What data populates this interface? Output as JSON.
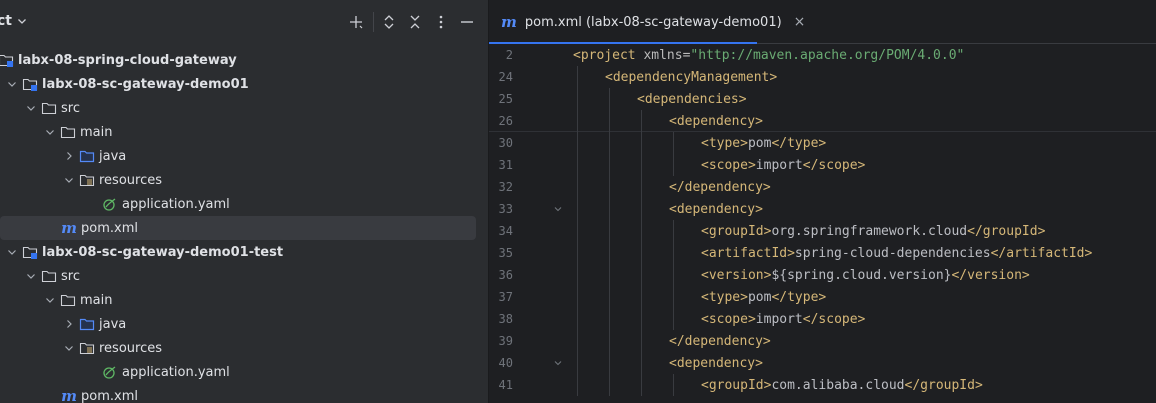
{
  "project_panel": {
    "title": "ct",
    "tree": [
      {
        "label": "labx-08-spring-cloud-gateway",
        "bold": true,
        "type": "module",
        "indent": 0,
        "arrow": "none"
      },
      {
        "label": "labx-08-sc-gateway-demo01",
        "bold": true,
        "type": "module",
        "indent": 0,
        "arrow": "down"
      },
      {
        "label": "src",
        "bold": false,
        "type": "folder",
        "indent": 1,
        "arrow": "down"
      },
      {
        "label": "main",
        "bold": false,
        "type": "folder",
        "indent": 2,
        "arrow": "down"
      },
      {
        "label": "java",
        "bold": false,
        "type": "source-folder",
        "indent": 3,
        "arrow": "right"
      },
      {
        "label": "resources",
        "bold": false,
        "type": "resources-folder",
        "indent": 3,
        "arrow": "down"
      },
      {
        "label": "application.yaml",
        "bold": false,
        "type": "spring-file",
        "indent": 4,
        "arrow": "none"
      },
      {
        "label": "pom.xml",
        "bold": false,
        "type": "maven-file",
        "indent": 1,
        "arrow": "none",
        "selected": true
      },
      {
        "label": "labx-08-sc-gateway-demo01-test",
        "bold": true,
        "type": "module",
        "indent": 0,
        "arrow": "down"
      },
      {
        "label": "src",
        "bold": false,
        "type": "folder",
        "indent": 1,
        "arrow": "down"
      },
      {
        "label": "main",
        "bold": false,
        "type": "folder",
        "indent": 2,
        "arrow": "down"
      },
      {
        "label": "java",
        "bold": false,
        "type": "source-folder",
        "indent": 3,
        "arrow": "right"
      },
      {
        "label": "resources",
        "bold": false,
        "type": "resources-folder",
        "indent": 3,
        "arrow": "down"
      },
      {
        "label": "application.yaml",
        "bold": false,
        "type": "spring-file",
        "indent": 4,
        "arrow": "none"
      },
      {
        "label": "pom.xml",
        "bold": false,
        "type": "maven-file",
        "indent": 1,
        "arrow": "none"
      }
    ],
    "header_icons": [
      "add-icon",
      "expand-all-icon",
      "collapse-all-icon",
      "more-icon",
      "minimize-icon"
    ]
  },
  "editor": {
    "tab": {
      "icon_glyph": "m",
      "label": "pom.xml (labx-08-sc-gateway-demo01)",
      "close_glyph": "×"
    },
    "sticky_lines": [
      {
        "num": "2",
        "indent": 0,
        "parts": [
          [
            "tag",
            "<project "
          ],
          [
            "attr",
            "xmlns="
          ],
          [
            "aval",
            "\"http://maven.apache.org/POM/4.0.0\""
          ]
        ]
      },
      {
        "num": "24",
        "indent": 1,
        "parts": [
          [
            "tag",
            "<dependencyManagement>"
          ]
        ]
      },
      {
        "num": "25",
        "indent": 2,
        "parts": [
          [
            "tag",
            "<dependencies>"
          ]
        ]
      },
      {
        "num": "26",
        "indent": 3,
        "parts": [
          [
            "tag",
            "<dependency>"
          ]
        ]
      }
    ],
    "lines": [
      {
        "num": "30",
        "indent": 4,
        "parts": [
          [
            "tag",
            "<type>"
          ],
          [
            "txt",
            "pom"
          ],
          [
            "tag",
            "</type>"
          ]
        ]
      },
      {
        "num": "31",
        "indent": 4,
        "parts": [
          [
            "tag",
            "<scope>"
          ],
          [
            "txt",
            "import"
          ],
          [
            "tag",
            "</scope>"
          ]
        ]
      },
      {
        "num": "32",
        "indent": 3,
        "parts": [
          [
            "tag",
            "</dependency>"
          ]
        ]
      },
      {
        "num": "33",
        "indent": 3,
        "fold": true,
        "parts": [
          [
            "tag",
            "<dependency>"
          ]
        ]
      },
      {
        "num": "34",
        "indent": 4,
        "parts": [
          [
            "tag",
            "<groupId>"
          ],
          [
            "txt",
            "org.springframework.cloud"
          ],
          [
            "tag",
            "</groupId>"
          ]
        ]
      },
      {
        "num": "35",
        "indent": 4,
        "parts": [
          [
            "tag",
            "<artifactId>"
          ],
          [
            "txt",
            "spring-cloud-dependencies"
          ],
          [
            "tag",
            "</artifactId>"
          ]
        ]
      },
      {
        "num": "36",
        "indent": 4,
        "parts": [
          [
            "tag",
            "<version>"
          ],
          [
            "txt",
            "${spring.cloud.version}"
          ],
          [
            "tag",
            "</version>"
          ]
        ]
      },
      {
        "num": "37",
        "indent": 4,
        "parts": [
          [
            "tag",
            "<type>"
          ],
          [
            "txt",
            "pom"
          ],
          [
            "tag",
            "</type>"
          ]
        ]
      },
      {
        "num": "38",
        "indent": 4,
        "parts": [
          [
            "tag",
            "<scope>"
          ],
          [
            "txt",
            "import"
          ],
          [
            "tag",
            "</scope>"
          ]
        ]
      },
      {
        "num": "39",
        "indent": 3,
        "parts": [
          [
            "tag",
            "</dependency>"
          ]
        ]
      },
      {
        "num": "40",
        "indent": 3,
        "fold": true,
        "parts": [
          [
            "tag",
            "<dependency>"
          ]
        ]
      },
      {
        "num": "41",
        "indent": 4,
        "parts": [
          [
            "tag",
            "<groupId>"
          ],
          [
            "txt",
            "com.alibaba.cloud"
          ],
          [
            "tag",
            "</groupId>"
          ]
        ]
      }
    ]
  }
}
